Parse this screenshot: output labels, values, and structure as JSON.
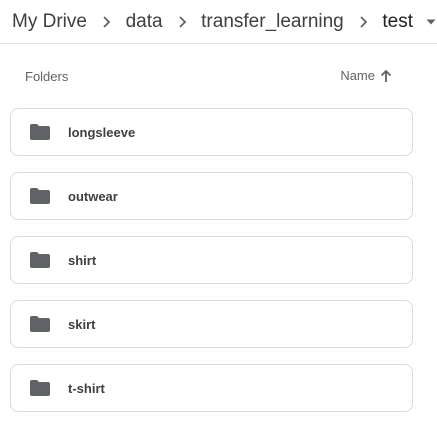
{
  "breadcrumb": {
    "items": [
      "My Drive",
      "data",
      "transfer_learning"
    ],
    "current": "test"
  },
  "header": {
    "folders_label": "Folders",
    "sort_label": "Name"
  },
  "folders": [
    {
      "name": "longsleeve"
    },
    {
      "name": "outwear"
    },
    {
      "name": "shirt"
    },
    {
      "name": "skirt"
    },
    {
      "name": "t-shirt"
    }
  ],
  "icons": {
    "separator": "chevron-right-icon",
    "dropdown": "triangle-down-icon",
    "sort": "arrow-up-icon",
    "folder": "folder-icon"
  },
  "colors": {
    "text": "#3c4043",
    "secondary": "#5f6368",
    "border": "#dadce0",
    "icon": "#5f6368"
  }
}
